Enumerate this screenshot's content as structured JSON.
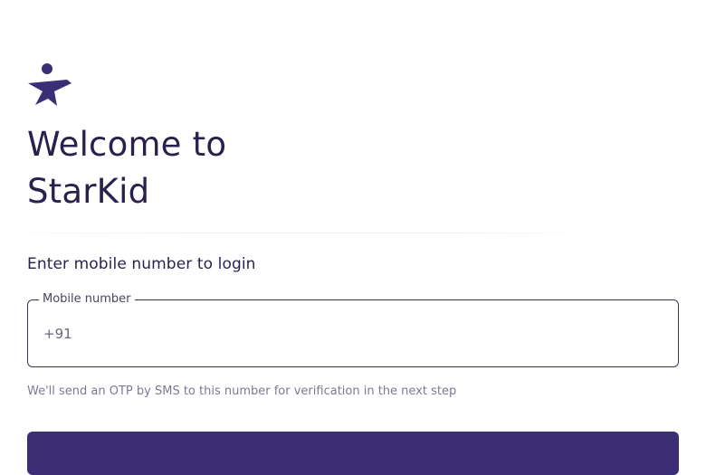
{
  "app": {
    "logo_icon": "starkid-star-person-icon",
    "brand_color": "#3b2e74"
  },
  "header": {
    "title": "Welcome to StarKid"
  },
  "login": {
    "subtitle": "Enter mobile number to login",
    "mobile_field": {
      "label": "Mobile number",
      "prefix": "+91",
      "value": "",
      "placeholder": ""
    },
    "helper_text": "We'll send an OTP by SMS to this number for verification in the next step",
    "submit_label": ""
  }
}
